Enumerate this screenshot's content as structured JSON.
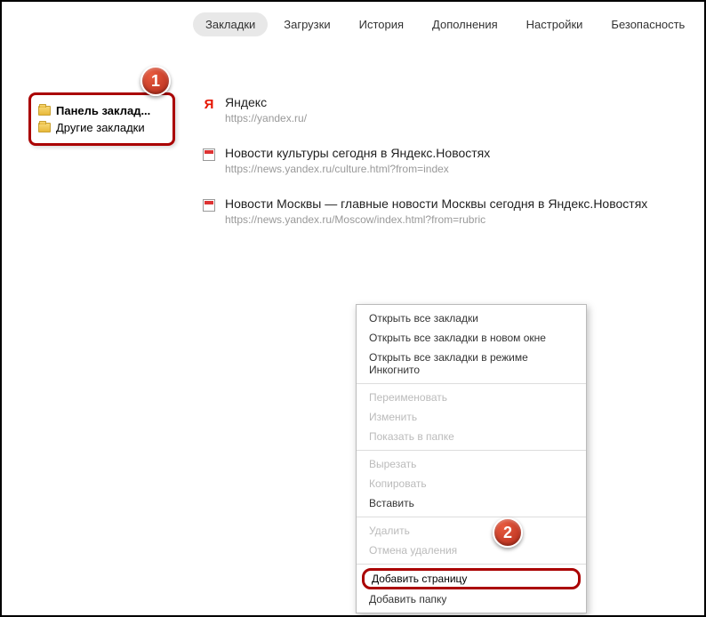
{
  "tabs": [
    {
      "label": "Закладки",
      "active": true
    },
    {
      "label": "Загрузки",
      "active": false
    },
    {
      "label": "История",
      "active": false
    },
    {
      "label": "Дополнения",
      "active": false
    },
    {
      "label": "Настройки",
      "active": false
    },
    {
      "label": "Безопасность",
      "active": false
    }
  ],
  "sidebar": {
    "items": [
      {
        "label": "Панель заклад...",
        "active": true
      },
      {
        "label": "Другие закладки",
        "active": false
      }
    ]
  },
  "badges": {
    "one": "1",
    "two": "2"
  },
  "bookmarks": [
    {
      "title": "Яндекс",
      "url": "https://yandex.ru/",
      "icon": "yandex"
    },
    {
      "title": "Новости культуры сегодня в Яндекс.Новостях",
      "url": "https://news.yandex.ru/culture.html?from=index",
      "icon": "news"
    },
    {
      "title": "Новости Москвы — главные новости Москвы сегодня в Яндекс.Новостях",
      "url": "https://news.yandex.ru/Moscow/index.html?from=rubric",
      "icon": "news"
    }
  ],
  "context_menu": {
    "groups": [
      [
        {
          "label": "Открыть все закладки",
          "enabled": true
        },
        {
          "label": "Открыть все закладки в новом окне",
          "enabled": true
        },
        {
          "label": "Открыть все закладки в режиме Инкогнито",
          "enabled": true
        }
      ],
      [
        {
          "label": "Переименовать",
          "enabled": false
        },
        {
          "label": "Изменить",
          "enabled": false
        },
        {
          "label": "Показать в папке",
          "enabled": false
        }
      ],
      [
        {
          "label": "Вырезать",
          "enabled": false
        },
        {
          "label": "Копировать",
          "enabled": false
        },
        {
          "label": "Вставить",
          "enabled": true
        }
      ],
      [
        {
          "label": "Удалить",
          "enabled": false
        },
        {
          "label": "Отмена удаления",
          "enabled": false
        }
      ]
    ],
    "highlighted": {
      "label": "Добавить страницу"
    },
    "last": {
      "label": "Добавить папку"
    }
  }
}
